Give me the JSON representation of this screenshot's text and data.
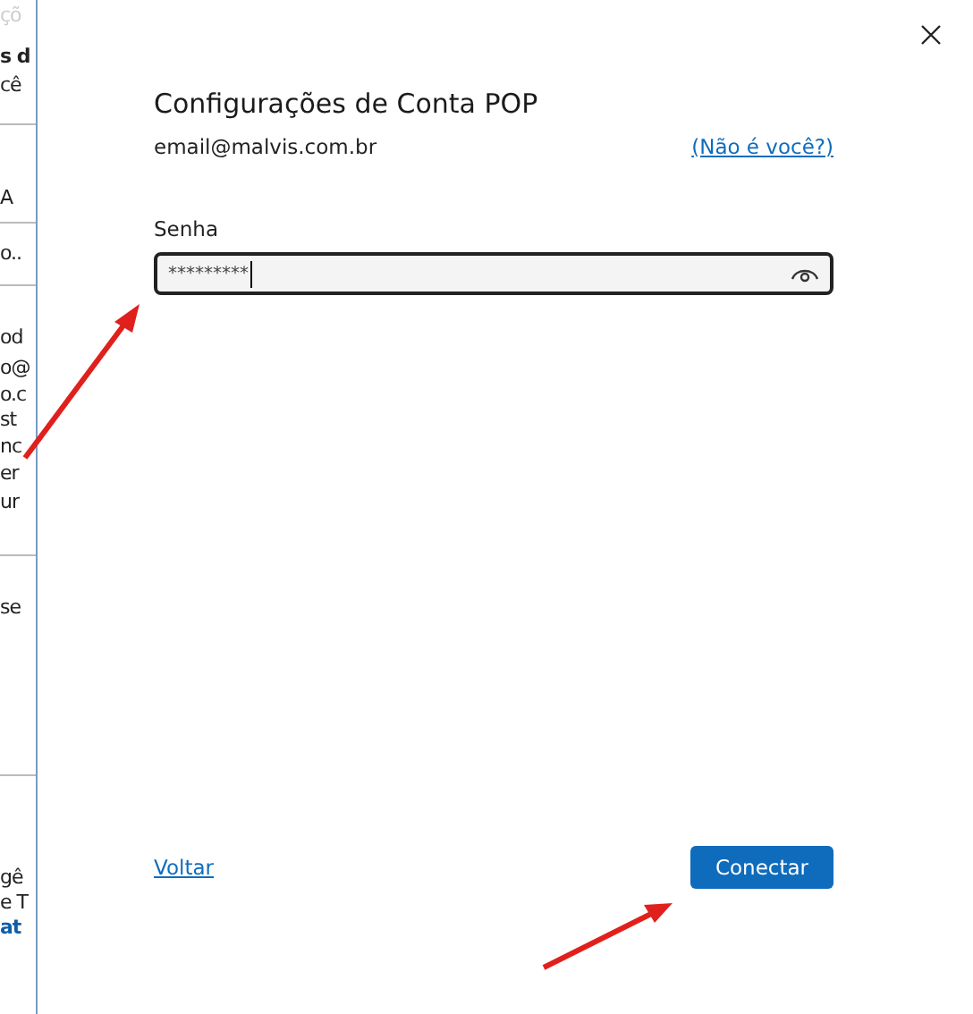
{
  "background_window": {
    "fragments": [
      {
        "text": "çõ",
        "kind": "faint"
      },
      {
        "text": "s d",
        "kind": "bold"
      },
      {
        "text": "cê",
        "kind": "text"
      },
      {
        "text": "A",
        "kind": "text"
      },
      {
        "text": "o..",
        "kind": "text"
      },
      {
        "text": "od",
        "kind": "text"
      },
      {
        "text": "o@",
        "kind": "text"
      },
      {
        "text": "o.c",
        "kind": "text"
      },
      {
        "text": "st",
        "kind": "text"
      },
      {
        "text": "nc",
        "kind": "text"
      },
      {
        "text": "er",
        "kind": "text"
      },
      {
        "text": "ur",
        "kind": "text"
      },
      {
        "text": "se",
        "kind": "text"
      },
      {
        "text": "gê",
        "kind": "text"
      },
      {
        "text": "e T",
        "kind": "text"
      },
      {
        "text": "at",
        "kind": "link"
      }
    ]
  },
  "dialog": {
    "title": "Configurações de Conta POP",
    "email": "email@malvis.com.br",
    "not_you_link": "(Não é você?)",
    "password": {
      "label": "Senha",
      "value": "*********"
    },
    "back_link": "Voltar",
    "connect_button": "Conectar"
  }
}
